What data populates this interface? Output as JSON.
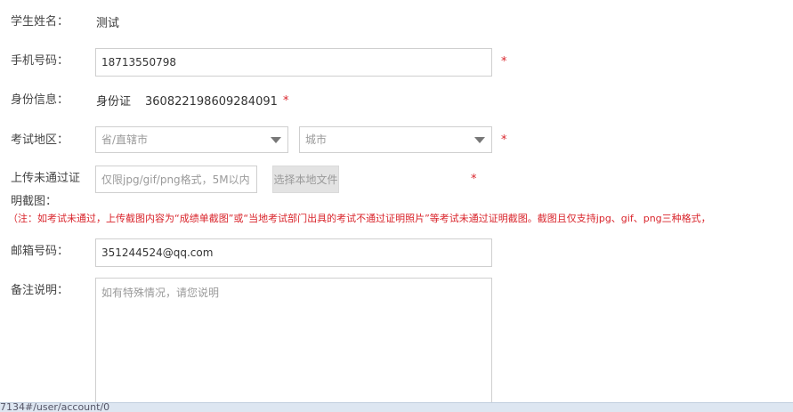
{
  "form": {
    "student_name_label": "学生姓名：",
    "student_name_value": "测试",
    "phone_label": "手机号码：",
    "phone_value": "18713550798",
    "id_label": "身份信息：",
    "id_type": "身份证",
    "id_number": "360822198609284091",
    "region_label": "考试地区：",
    "province_placeholder": "省/直辖市",
    "city_placeholder": "城市",
    "upload_label_line1": "上传未通过证",
    "upload_label_line2": "明截图：",
    "upload_placeholder": "仅限jpg/gif/png格式，5M以内",
    "upload_button": "选择本地文件",
    "upload_note": "（注：如考试未通过，上传截图内容为“成绩单截图”或“当地考试部门出具的考试不通过证明照片”等考试未通过证明截图。截图且仅支持jpg、gif、png三种格式，",
    "email_label": "邮箱号码：",
    "email_value": "351244524@qq.com",
    "remark_label": "备注说明：",
    "remark_placeholder": "如有特殊情况，请您说明",
    "required_mark": "*"
  },
  "status_bar": {
    "url_fragment": "7134#/user/account/0"
  }
}
